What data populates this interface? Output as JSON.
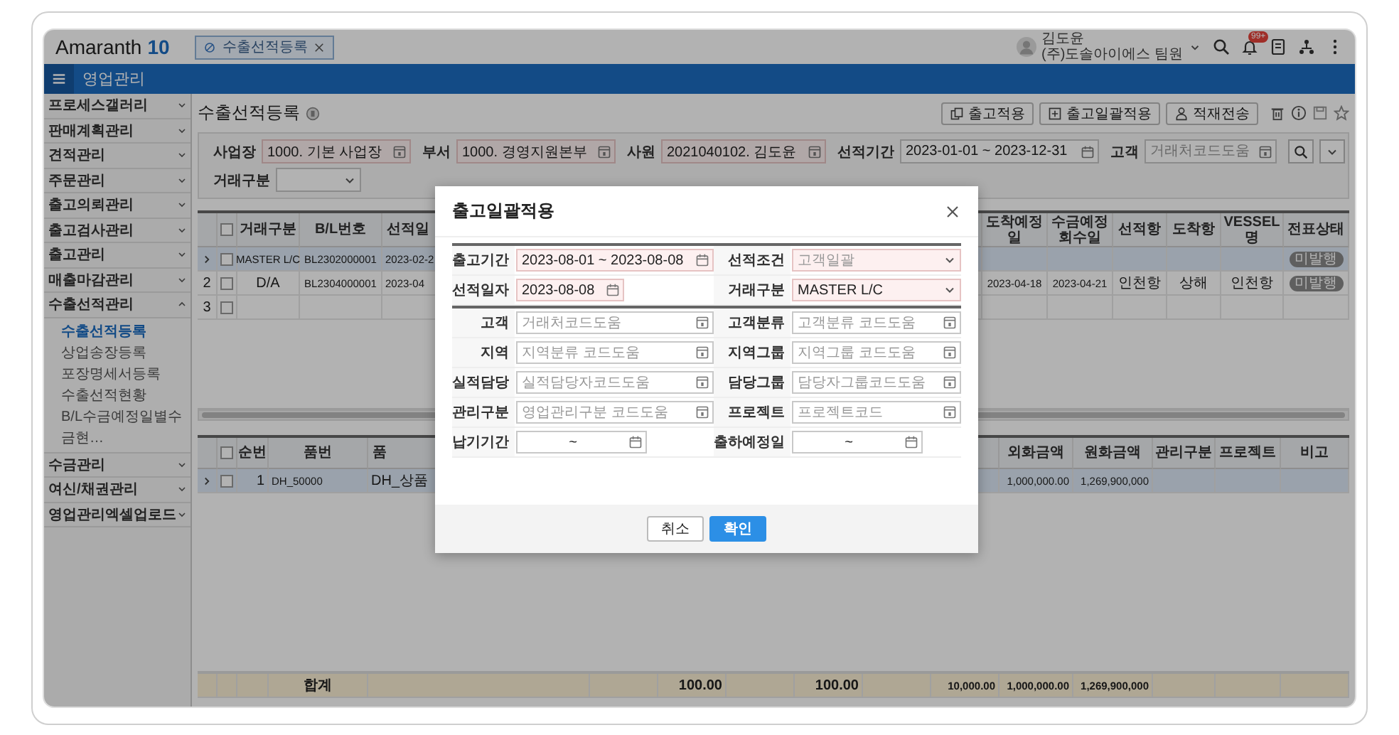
{
  "topbar": {
    "logo": "Amaranth",
    "logo_number": "10",
    "tabs": [
      {
        "label": "수출선적등록",
        "selected": true
      }
    ],
    "user": {
      "name": "김도윤",
      "org": "(주)도솔아이에스 팀원"
    },
    "notification_count": "99+"
  },
  "menu_bar": {
    "title": "영업관리"
  },
  "sidebar": {
    "items": [
      {
        "label": "프로세스갤러리",
        "expanded": false
      },
      {
        "label": "판매계획관리",
        "expanded": false
      },
      {
        "label": "견적관리",
        "expanded": false
      },
      {
        "label": "주문관리",
        "expanded": false
      },
      {
        "label": "출고의뢰관리",
        "expanded": false
      },
      {
        "label": "출고검사관리",
        "expanded": false
      },
      {
        "label": "출고관리",
        "expanded": false
      },
      {
        "label": "매출마감관리",
        "expanded": false
      },
      {
        "label": "수출선적관리",
        "expanded": true,
        "children": [
          {
            "label": "수출선적등록",
            "selected": true
          },
          {
            "label": "상업송장등록",
            "selected": false
          },
          {
            "label": "포장명세서등록",
            "selected": false
          },
          {
            "label": "수출선적현황",
            "selected": false
          },
          {
            "label": "B/L수금예정일별수금현…",
            "selected": false
          }
        ]
      },
      {
        "label": "수금관리",
        "expanded": false
      },
      {
        "label": "여신/채권관리",
        "expanded": false
      },
      {
        "label": "영업관리엑셀업로드",
        "expanded": false
      }
    ]
  },
  "page": {
    "title": "수출선적등록",
    "actions": [
      {
        "label": "출고적용",
        "kind": "copy"
      },
      {
        "label": "출고일괄적용",
        "kind": "plus"
      },
      {
        "label": "적재전송",
        "kind": "person"
      }
    ]
  },
  "filters": [
    {
      "label": "사업장",
      "kind": "code",
      "value": "1000. 기본 사업장",
      "required": true
    },
    {
      "label": "부서",
      "kind": "code",
      "value": "1000. 경영지원본부",
      "required": true
    },
    {
      "label": "사원",
      "kind": "code",
      "value": "2021040102. 김도윤",
      "required": true
    },
    {
      "label": "선적기간",
      "kind": "date",
      "value": "2023-01-01 ~ 2023-12-31",
      "required": false
    },
    {
      "label": "고객",
      "kind": "code",
      "placeholder": "거래처코드도움",
      "required": false
    },
    {
      "label": "거래구분",
      "kind": "select",
      "required": false
    }
  ],
  "shipment_grid": {
    "all_checked": false,
    "columns": [
      {
        "header": "거래구분",
        "kind": "text"
      },
      {
        "header": "B/L번호",
        "kind": "text"
      },
      {
        "header": "선적일",
        "kind": "text"
      },
      {},
      {
        "header": "도착예정일",
        "kind": "text"
      },
      {
        "header": "수금예정회수일",
        "kind": "text"
      },
      {
        "header": "선적항",
        "kind": "text"
      },
      {
        "header": "도착항",
        "kind": "text"
      },
      {
        "header": "VESSEL명",
        "kind": "text"
      },
      {
        "header": "전표상태",
        "kind": "badge"
      }
    ],
    "rows": [
      {
        "selected": true,
        "checked": false,
        "cells": [
          "MASTER L/C",
          "BL2302000001",
          "2023-02-2",
          null,
          null,
          null,
          null,
          null,
          null,
          "미발행"
        ]
      },
      {
        "number": "2",
        "selected": false,
        "checked": false,
        "cells": [
          "D/A",
          "BL2304000001",
          "2023-04",
          null,
          "2023-04-18",
          "2023-04-21",
          "인천항",
          "상해",
          "인천항",
          "미발행"
        ]
      },
      {
        "number": "3",
        "selected": false,
        "checked": false,
        "cells": [
          null,
          null,
          null,
          null,
          null,
          null,
          null,
          null,
          null,
          null
        ]
      }
    ]
  },
  "item_grid": {
    "all_checked": false,
    "columns": [
      {
        "header": "순번"
      },
      {
        "header": "품번"
      },
      {
        "header": "품"
      },
      {},
      {},
      {},
      {},
      {},
      {},
      {
        "header": "외화금액"
      },
      {
        "header": "원화금액"
      },
      {
        "header": "관리구분"
      },
      {
        "header": "프로젝트"
      },
      {
        "header": "비고"
      }
    ],
    "rows": [
      {
        "kind": "item",
        "selected": true,
        "checked": false,
        "cells": [
          "1",
          "DH_50000",
          "DH_상품",
          null,
          null,
          null,
          null,
          null,
          null,
          "1,000,000.00",
          "1,269,900,000",
          null,
          null,
          null
        ]
      },
      {
        "kind": "total",
        "cells": [
          null,
          "합계",
          null,
          null,
          "100.00",
          null,
          "100.00",
          null,
          "10,000.00",
          "1,000,000.00",
          "1,269,900,000",
          null,
          null,
          null
        ]
      }
    ]
  },
  "modal": {
    "title": "출고일괄적용",
    "sections": [
      {
        "rows": [
          [
            {
              "label": "출고기간",
              "kind": "date",
              "value": "2023-08-01 ~ 2023-08-08",
              "required": true
            },
            {
              "label": "선적조건",
              "kind": "select",
              "placeholder": "고객일괄",
              "required": true
            }
          ],
          [
            {
              "label": "선적일자",
              "kind": "date",
              "value": "2023-08-08",
              "required": true
            },
            {
              "label": "거래구분",
              "kind": "select",
              "value": "MASTER L/C",
              "required": true
            }
          ]
        ]
      },
      {
        "rows": [
          [
            {
              "label": "고객",
              "kind": "code",
              "placeholder": "거래처코드도움",
              "required": false
            },
            {
              "label": "고객분류",
              "kind": "code",
              "placeholder": "고객분류 코드도움",
              "required": false
            }
          ],
          [
            {
              "label": "지역",
              "kind": "code",
              "placeholder": "지역분류 코드도움",
              "required": false
            },
            {
              "label": "지역그룹",
              "kind": "code",
              "placeholder": "지역그룹 코드도움",
              "required": false
            }
          ],
          [
            {
              "label": "실적담당",
              "kind": "code",
              "placeholder": "실적담당자코드도움",
              "required": false
            },
            {
              "label": "담당그룹",
              "kind": "code",
              "placeholder": "담당자그룹코드도움",
              "required": false
            }
          ],
          [
            {
              "label": "관리구분",
              "kind": "code",
              "placeholder": "영업관리구분 코드도움",
              "required": false
            },
            {
              "label": "프로젝트",
              "kind": "code",
              "placeholder": "프로젝트코드",
              "required": false
            }
          ],
          [
            {
              "label": "납기기간",
              "kind": "date_range",
              "value": "~",
              "required": false
            },
            {
              "label": "출하예정일",
              "kind": "date_range",
              "value": "~",
              "required": false
            }
          ]
        ]
      }
    ],
    "buttons": [
      {
        "label": "취소",
        "kind": "secondary"
      },
      {
        "label": "확인",
        "kind": "primary"
      }
    ]
  }
}
